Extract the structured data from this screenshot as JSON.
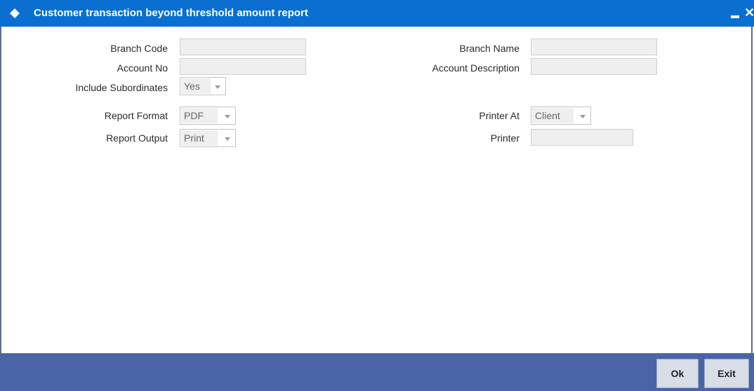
{
  "window": {
    "title": "Customer transaction beyond threshold amount report",
    "minimize_icon": "minimize-icon",
    "close_icon": "close-icon",
    "close_glyph": "✕",
    "title_color": "#0a6fd1",
    "footer_color": "#4a65a5"
  },
  "form": {
    "branch_code": {
      "label": "Branch Code",
      "value": ""
    },
    "branch_name": {
      "label": "Branch Name",
      "value": ""
    },
    "account_no": {
      "label": "Account No",
      "value": ""
    },
    "account_description": {
      "label": "Account Description",
      "value": ""
    },
    "include_subordinates": {
      "label": "Include Subordinates",
      "value": "Yes"
    },
    "report_format": {
      "label": "Report Format",
      "value": "PDF"
    },
    "report_output": {
      "label": "Report Output",
      "value": "Print"
    },
    "printer_at": {
      "label": "Printer At",
      "value": "Client"
    },
    "printer": {
      "label": "Printer",
      "value": ""
    }
  },
  "footer": {
    "ok_label": "Ok",
    "exit_label": "Exit"
  }
}
